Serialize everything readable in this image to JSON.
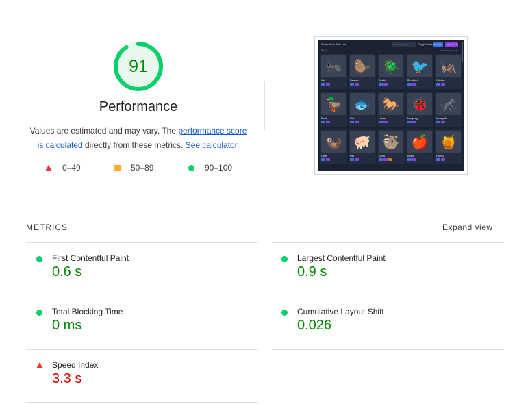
{
  "gauge": {
    "score": "91",
    "fraction": 0.91,
    "color": "#0cce6b"
  },
  "performance": {
    "title": "Performance",
    "desc_prefix": "Values are estimated and may vary. The ",
    "link_score": "performance score is calculated",
    "desc_middle": " directly from these metrics. ",
    "link_calc": "See calculator."
  },
  "legend": [
    {
      "range": "0–49",
      "icon": "red-triangle"
    },
    {
      "range": "50–89",
      "icon": "orange-square"
    },
    {
      "range": "90–100",
      "icon": "green-circle"
    }
  ],
  "screenshot": {
    "title": "Super Auto Pets List",
    "search_placeholder": "Search by name",
    "toggle_label": "Toggle Packs",
    "btn1": "Standard",
    "btn2": "Expansion 1",
    "tier_label": "Tier 1",
    "available_label": "Available packs: 2",
    "pets": [
      {
        "name": "Ant",
        "glyph": "🐜"
      },
      {
        "name": "Beaver",
        "glyph": "🦫"
      },
      {
        "name": "Beetle",
        "glyph": "🪲"
      },
      {
        "name": "Bluebird",
        "glyph": "🐦"
      },
      {
        "name": "Cricket",
        "glyph": "🦗"
      },
      {
        "name": "Duck",
        "glyph": "🦆"
      },
      {
        "name": "Fish",
        "glyph": "🐟"
      },
      {
        "name": "Horse",
        "glyph": "🐎"
      },
      {
        "name": "Ladybug",
        "glyph": "🐞"
      },
      {
        "name": "Mosquito",
        "glyph": "🦟"
      },
      {
        "name": "Otter",
        "glyph": "🦦"
      },
      {
        "name": "Pig",
        "glyph": "🐖"
      },
      {
        "name": "Sloth",
        "glyph": "🦥"
      },
      {
        "name": "Apple",
        "glyph": "🍎"
      },
      {
        "name": "Honey",
        "glyph": "🍯"
      }
    ]
  },
  "metrics": {
    "title": "METRICS",
    "expand_label": "Expand view",
    "items": [
      {
        "label": "First Contentful Paint",
        "value": "0.6 s",
        "status": "good"
      },
      {
        "label": "Largest Contentful Paint",
        "value": "0.9 s",
        "status": "good"
      },
      {
        "label": "Total Blocking Time",
        "value": "0 ms",
        "status": "good"
      },
      {
        "label": "Cumulative Layout Shift",
        "value": "0.026",
        "status": "good"
      },
      {
        "label": "Speed Index",
        "value": "3.3 s",
        "status": "bad"
      }
    ]
  }
}
